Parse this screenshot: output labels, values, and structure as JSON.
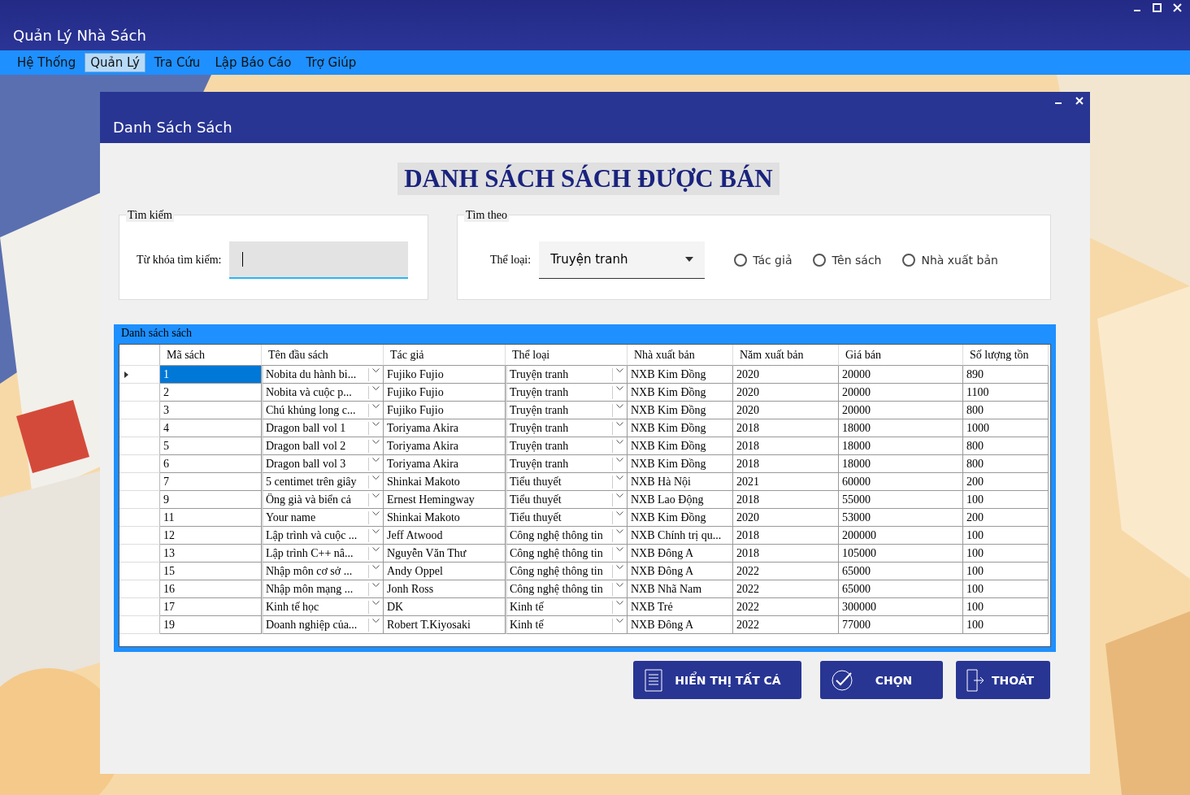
{
  "window": {
    "title": "Quản Lý Nhà Sách"
  },
  "menu": [
    {
      "label": "Hệ Thống",
      "selected": false
    },
    {
      "label": "Quản Lý",
      "selected": true
    },
    {
      "label": "Tra Cứu",
      "selected": false
    },
    {
      "label": "Lập Báo Cáo",
      "selected": false
    },
    {
      "label": "Trợ Giúp",
      "selected": false
    }
  ],
  "form": {
    "title": "Danh Sách Sách",
    "heading": "DANH SÁCH SÁCH ĐƯỢC BÁN",
    "search_group": {
      "legend": "Tìm kiếm",
      "label": "Từ khóa tìm kiếm:"
    },
    "filter_group": {
      "legend": "Tìm theo",
      "label": "Thể loại:",
      "dropdown_value": "Truyện tranh",
      "options": [
        {
          "label": "Tác giả",
          "selected": false
        },
        {
          "label": "Tên sách",
          "selected": false
        },
        {
          "label": "Nhà xuất bản",
          "selected": false
        }
      ]
    },
    "grid": {
      "legend": "Danh sách sách",
      "columns": [
        {
          "label": "Mã sách",
          "kind": "text"
        },
        {
          "label": "Tên đầu sách",
          "kind": "combo"
        },
        {
          "label": "Tác giả",
          "kind": "text"
        },
        {
          "label": "Thể loại",
          "kind": "combo"
        },
        {
          "label": "Nhà xuất bản",
          "kind": "text"
        },
        {
          "label": "Năm xuất bản",
          "kind": "text"
        },
        {
          "label": "Giá bán",
          "kind": "text"
        },
        {
          "label": "Số lượng tồn",
          "kind": "text"
        }
      ],
      "rows": [
        {
          "selected": true,
          "cells": [
            "1",
            "Nobita du hành bi...",
            "Fujiko Fujio",
            "Truyện tranh",
            "NXB Kim Đồng",
            "2020",
            "20000",
            "890"
          ]
        },
        {
          "selected": false,
          "cells": [
            "2",
            "Nobita và cuộc p...",
            "Fujiko Fujio",
            "Truyện tranh",
            "NXB Kim Đồng",
            "2020",
            "20000",
            "1100"
          ]
        },
        {
          "selected": false,
          "cells": [
            "3",
            "Chú khủng long c...",
            "Fujiko Fujio",
            "Truyện tranh",
            "NXB Kim Đồng",
            "2020",
            "20000",
            "800"
          ]
        },
        {
          "selected": false,
          "cells": [
            "4",
            "Dragon ball vol 1",
            "Toriyama Akira",
            "Truyện tranh",
            "NXB Kim Đồng",
            "2018",
            "18000",
            "1000"
          ]
        },
        {
          "selected": false,
          "cells": [
            "5",
            "Dragon ball vol 2",
            "Toriyama Akira",
            "Truyện tranh",
            "NXB Kim Đồng",
            "2018",
            "18000",
            "800"
          ]
        },
        {
          "selected": false,
          "cells": [
            "6",
            "Dragon ball vol 3",
            "Toriyama Akira",
            "Truyện tranh",
            "NXB Kim Đồng",
            "2018",
            "18000",
            "800"
          ]
        },
        {
          "selected": false,
          "cells": [
            "7",
            "5 centimet trên giây",
            "Shinkai Makoto",
            "Tiểu thuyết",
            "NXB Hà Nội",
            "2021",
            "60000",
            "200"
          ]
        },
        {
          "selected": false,
          "cells": [
            "9",
            "Ông già và biển cả",
            "Ernest Hemingway",
            "Tiểu thuyết",
            "NXB Lao Động",
            "2018",
            "55000",
            "100"
          ]
        },
        {
          "selected": false,
          "cells": [
            "11",
            "Your name",
            "Shinkai Makoto",
            "Tiểu thuyết",
            "NXB Kim Đồng",
            "2020",
            "53000",
            "200"
          ]
        },
        {
          "selected": false,
          "cells": [
            "12",
            "Lập trình và cuộc ...",
            "Jeff Atwood",
            "Công nghệ thông tin",
            "NXB Chính trị qu...",
            "2018",
            "200000",
            "100"
          ]
        },
        {
          "selected": false,
          "cells": [
            "13",
            "Lập trình C++ nâ...",
            "Nguyễn Văn Thư",
            "Công nghệ thông tin",
            "NXB Đông A",
            "2018",
            "105000",
            "100"
          ]
        },
        {
          "selected": false,
          "cells": [
            "15",
            "Nhập môn cơ sở ...",
            "Andy Oppel",
            "Công nghệ thông tin",
            "NXB Đông A",
            "2022",
            "65000",
            "100"
          ]
        },
        {
          "selected": false,
          "cells": [
            "16",
            "Nhập môn mạng ...",
            "Jonh Ross",
            "Công nghệ thông tin",
            "NXB Nhã Nam",
            "2022",
            "65000",
            "100"
          ]
        },
        {
          "selected": false,
          "cells": [
            "17",
            "Kinh tế học",
            "DK",
            "Kinh tế",
            "NXB Trẻ",
            "2022",
            "300000",
            "100"
          ]
        },
        {
          "selected": false,
          "cells": [
            "19",
            "Doanh nghiệp của...",
            "Robert T.Kiyosaki",
            "Kinh tế",
            "NXB Đông A",
            "2022",
            "77000",
            "100"
          ]
        }
      ]
    },
    "buttons": [
      {
        "label": "HIỂN THỊ TẤT CÁ",
        "kind": "list"
      },
      {
        "label": "CHỌN",
        "kind": "check"
      },
      {
        "label": "THOÁT",
        "kind": "exit"
      }
    ]
  }
}
